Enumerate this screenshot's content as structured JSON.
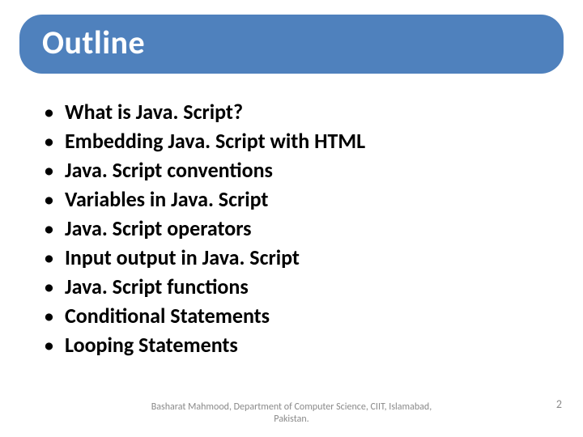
{
  "title": "Outline",
  "items": [
    "What is Java. Script?",
    "Embedding Java. Script with HTML",
    "Java. Script conventions",
    "Variables in Java. Script",
    "Java. Script operators",
    "Input output in Java. Script",
    "Java. Script functions",
    "Conditional Statements",
    "Looping Statements"
  ],
  "footer": {
    "author": "Basharat Mahmood, Department of Computer Science, CIIT, Islamabad, Pakistan.",
    "page": "2"
  }
}
